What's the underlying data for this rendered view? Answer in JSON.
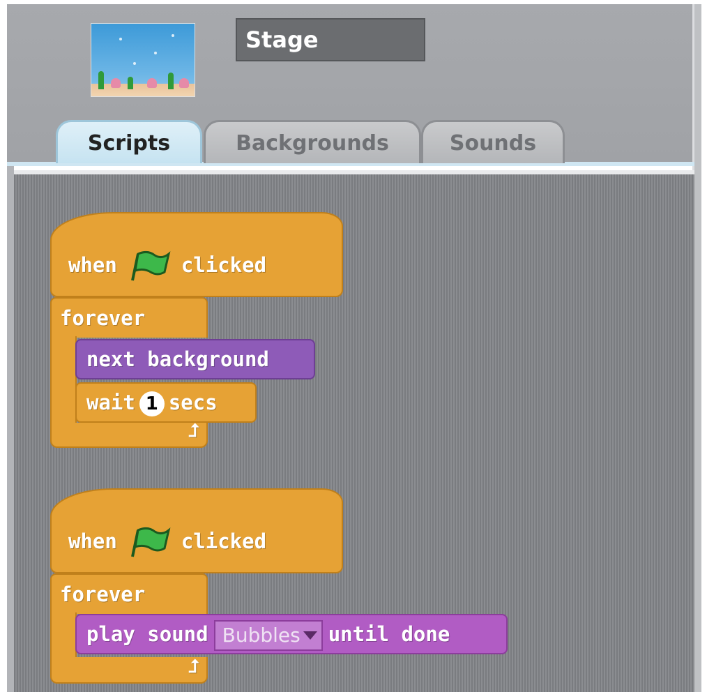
{
  "header": {
    "sprite_name": "Stage",
    "thumbnail_icon": "stage-thumbnail-underwater"
  },
  "tabs": [
    {
      "label": "Scripts",
      "active": true
    },
    {
      "label": "Backgrounds",
      "active": false
    },
    {
      "label": "Sounds",
      "active": false
    }
  ],
  "scripts": [
    {
      "hat": {
        "before": "when",
        "icon": "green-flag-icon",
        "after": "clicked"
      },
      "forever": {
        "label": "forever"
      },
      "body": [
        {
          "category": "looks",
          "text": "next background"
        },
        {
          "category": "control",
          "before": "wait",
          "value": "1",
          "after": "secs"
        }
      ]
    },
    {
      "hat": {
        "before": "when",
        "icon": "green-flag-icon",
        "after": "clicked"
      },
      "forever": {
        "label": "forever"
      },
      "body": [
        {
          "category": "sound",
          "before": "play sound",
          "dropdown": "Bubbles",
          "after": "until done"
        }
      ]
    }
  ],
  "colors": {
    "control": "#e6a235",
    "looks": "#8e5bb8",
    "sound": "#b15cc4",
    "flag": "#3db84a"
  }
}
